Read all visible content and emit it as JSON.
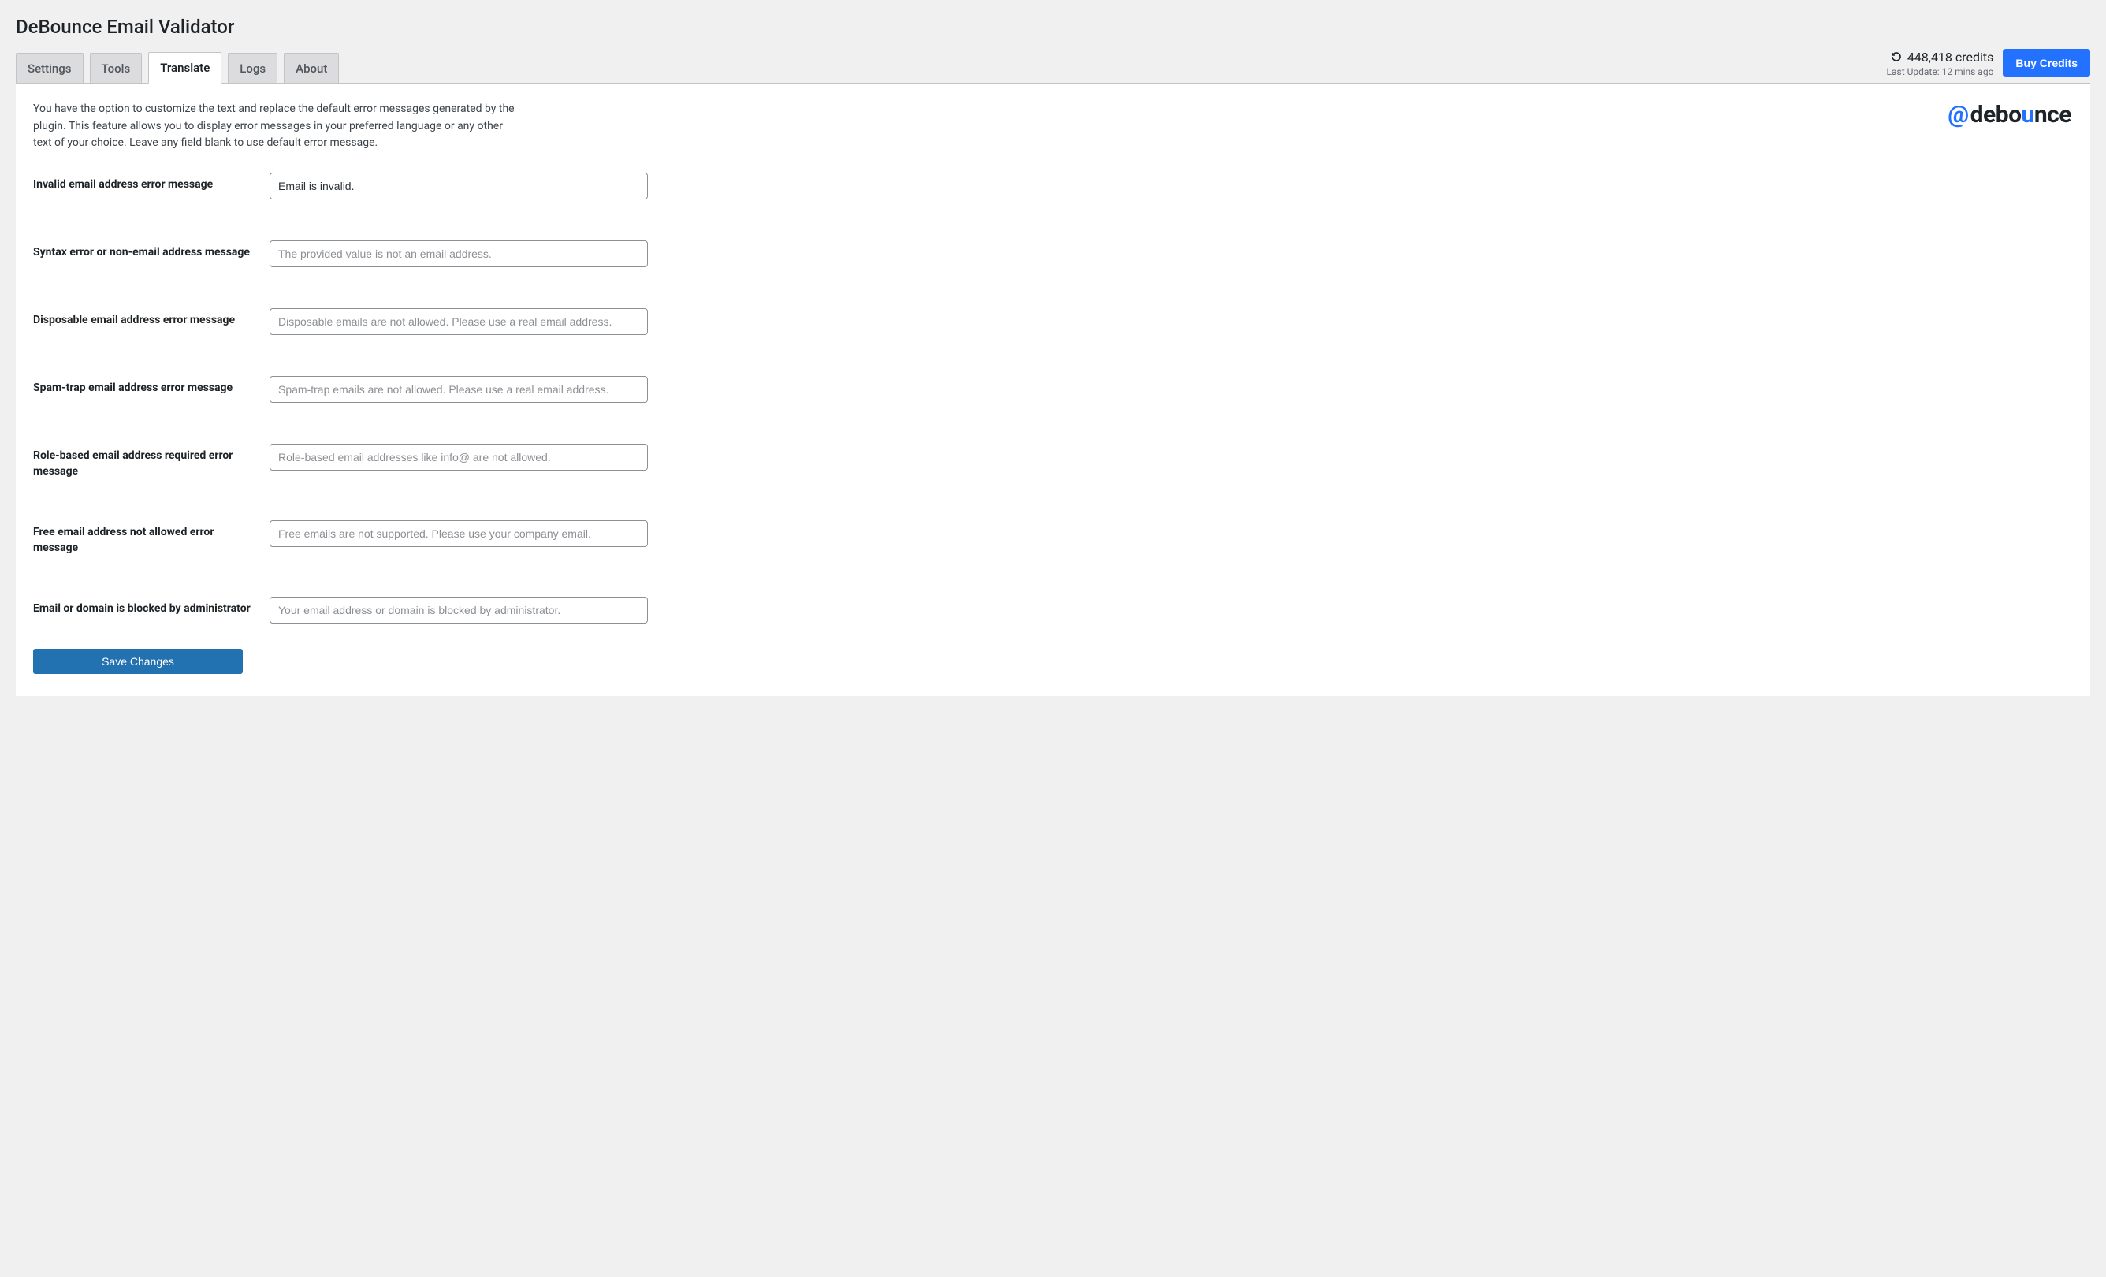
{
  "page_title": "DeBounce Email Validator",
  "tabs": [
    {
      "label": "Settings",
      "active": false
    },
    {
      "label": "Tools",
      "active": false
    },
    {
      "label": "Translate",
      "active": true
    },
    {
      "label": "Logs",
      "active": false
    },
    {
      "label": "About",
      "active": false
    }
  ],
  "credits": {
    "amount": "448,418 credits",
    "last_update": "Last Update: 12 mins ago",
    "buy_label": "Buy Credits"
  },
  "logo": {
    "at": "@",
    "text": "debounce"
  },
  "intro": "You have the option to customize the text and replace the default error messages generated by the plugin. This feature allows you to display error messages in your preferred language or any other text of your choice. Leave any field blank to use default error message.",
  "fields": {
    "invalid": {
      "label": "Invalid email address error message",
      "value": "Email is invalid.",
      "placeholder": ""
    },
    "syntax": {
      "label": "Syntax error or non-email address message",
      "value": "",
      "placeholder": "The provided value is not an email address."
    },
    "disposable": {
      "label": "Disposable email address error message",
      "value": "",
      "placeholder": "Disposable emails are not allowed. Please use a real email address."
    },
    "spamtrap": {
      "label": "Spam-trap email address error message",
      "value": "",
      "placeholder": "Spam-trap emails are not allowed. Please use a real email address."
    },
    "rolebased": {
      "label": "Role-based email address required error message",
      "value": "",
      "placeholder": "Role-based email addresses like info@ are not allowed."
    },
    "free": {
      "label": "Free email address not allowed error message",
      "value": "",
      "placeholder": "Free emails are not supported. Please use your company email."
    },
    "blocked": {
      "label": "Email or domain is blocked by administrator",
      "value": "",
      "placeholder": "Your email address or domain is blocked by administrator."
    }
  },
  "save_label": "Save Changes"
}
